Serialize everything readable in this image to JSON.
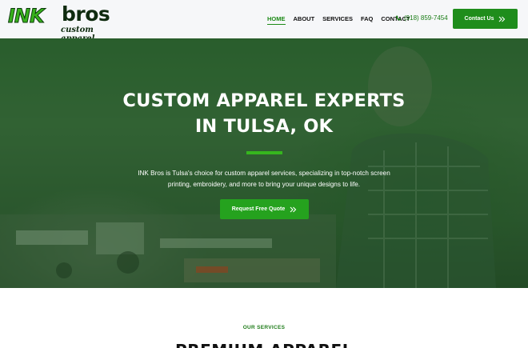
{
  "brand": {
    "logo_ink": "INK",
    "logo_bros": "bros",
    "logo_tagline": "custom apparel",
    "primary_color": "#1f8d1c",
    "accent_color": "#36b61e"
  },
  "nav": {
    "items": [
      {
        "label": "HOME",
        "active": true
      },
      {
        "label": "ABOUT",
        "active": false
      },
      {
        "label": "SERVICES",
        "active": false
      },
      {
        "label": "FAQ",
        "active": false
      },
      {
        "label": "CONTACT",
        "active": false
      }
    ],
    "phone": "(918) 859-7454",
    "phone_icon": "phone-icon",
    "contact_button": "Contact Us",
    "contact_button_icon": "double-chevron-right-icon"
  },
  "hero": {
    "title_line1": "CUSTOM APPAREL EXPERTS",
    "title_line2": "IN TULSA, OK",
    "description_line1": "INK Bros is Tulsa's choice for custom apparel services, specializing in top-notch screen",
    "description_line2": "printing, embroidery, and more to bring your unique designs to life.",
    "cta_label": "Request Free Quote",
    "cta_icon": "double-chevron-right-icon"
  },
  "services": {
    "eyebrow": "OUR SERVICES",
    "title": "PREMIUM APPAREL"
  }
}
